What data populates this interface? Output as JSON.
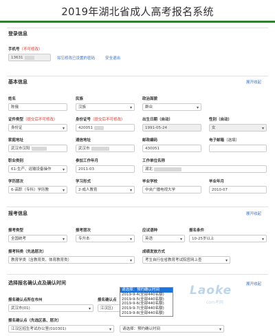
{
  "page_title": "2019年湖北省成人高考报名系统",
  "login": {
    "section_title": "登录信息",
    "phone_label": "手机号",
    "phone_note": "（不可修改）",
    "phone_value": "13631",
    "link_forgot": "如忘修改已设置的密码",
    "link_logout": "安全退出"
  },
  "basic": {
    "section_title": "基本信息",
    "toggle": "展开收起",
    "name_label": "姓名",
    "name_value": "陈俄",
    "ethnicity_label": "民族",
    "ethnicity_value": "汉族",
    "political_label": "政治面貌",
    "political_value": "群众",
    "idtype_label": "证件类型",
    "idtype_note": "（提交后不可修改）",
    "idtype_value": "身份证",
    "idno_label": "身份证号",
    "idno_note": "（提交后不可修改）",
    "idno_value": "420051",
    "birth_label": "出生日期（自动）",
    "birth_value": "1991-05-24",
    "gender_label": "性别（自动）",
    "gender_value": "女",
    "address_label": "家庭地址",
    "address_value": "武汉市汉阳",
    "mail_address_label": "通信地址",
    "mail_address_value": "武汉市",
    "postcode_label": "邮政编码",
    "postcode_value": "430051",
    "email_label": "电子邮箱",
    "email_note": "（选填）",
    "email_value": "",
    "occupation_label": "职业类别",
    "occupation_value": "61-生产、运输设备操作",
    "workdate_label": "参加工作年月",
    "workdate_value": "2011-03",
    "workplace_label": "工作单位名称",
    "workplace_value": "湖北",
    "edu_label": "学历层次",
    "edu_value": "6-高职（专科）学历教",
    "eduform_label": "学习形式",
    "eduform_value": "2-成人教育",
    "school_label": "毕业学校",
    "school_value": "中央广播电视大学",
    "gradyear_label": "毕业年月",
    "gradyear_value": "2010-07"
  },
  "exam": {
    "section_title": "报考信息",
    "toggle": "展开收起",
    "category_label": "报考类型",
    "category_value": "全国统考",
    "level_label": "报考层次",
    "level_value": "专升本",
    "language_label": "应试语种",
    "language_value": "英语",
    "condition_label": "报名条件",
    "condition_value": "10-25岁以上",
    "subject_label": "报考科类（先选层次）",
    "subject_value": "教育学类（含教育类、体育教育类）",
    "result_label": "成绩发放方式",
    "result_value": "考生自行在省教育考试院官网上查"
  },
  "confirm": {
    "section_title": "选择报名确认点及确认时间",
    "toggle": "展开收起",
    "city_label": "报名确认点所在市州",
    "city_value": "武汉市(01)",
    "point_label": "报名确认点",
    "point_value": "江汉区(",
    "office_label": "报名确认点（先选区县、层次）",
    "office_value": "江汉区招生考试办公室(010301)",
    "time_value": "请选择：预约确认时间",
    "dropdown": [
      "请选择：预约确认时间",
      "2019-9-4(全部440名额)",
      "2019-9-5(全部440名额)",
      "2019-9-6(全部440名额)",
      "2019-9-7(全部440名额)",
      "2019-9-8(全部440名额)"
    ]
  },
  "watermark": {
    "text": "Laoke",
    "sub": "com考网"
  },
  "colors": {
    "accent": "#2e7d32",
    "link": "#3a6fd3",
    "required": "#d9362b"
  }
}
